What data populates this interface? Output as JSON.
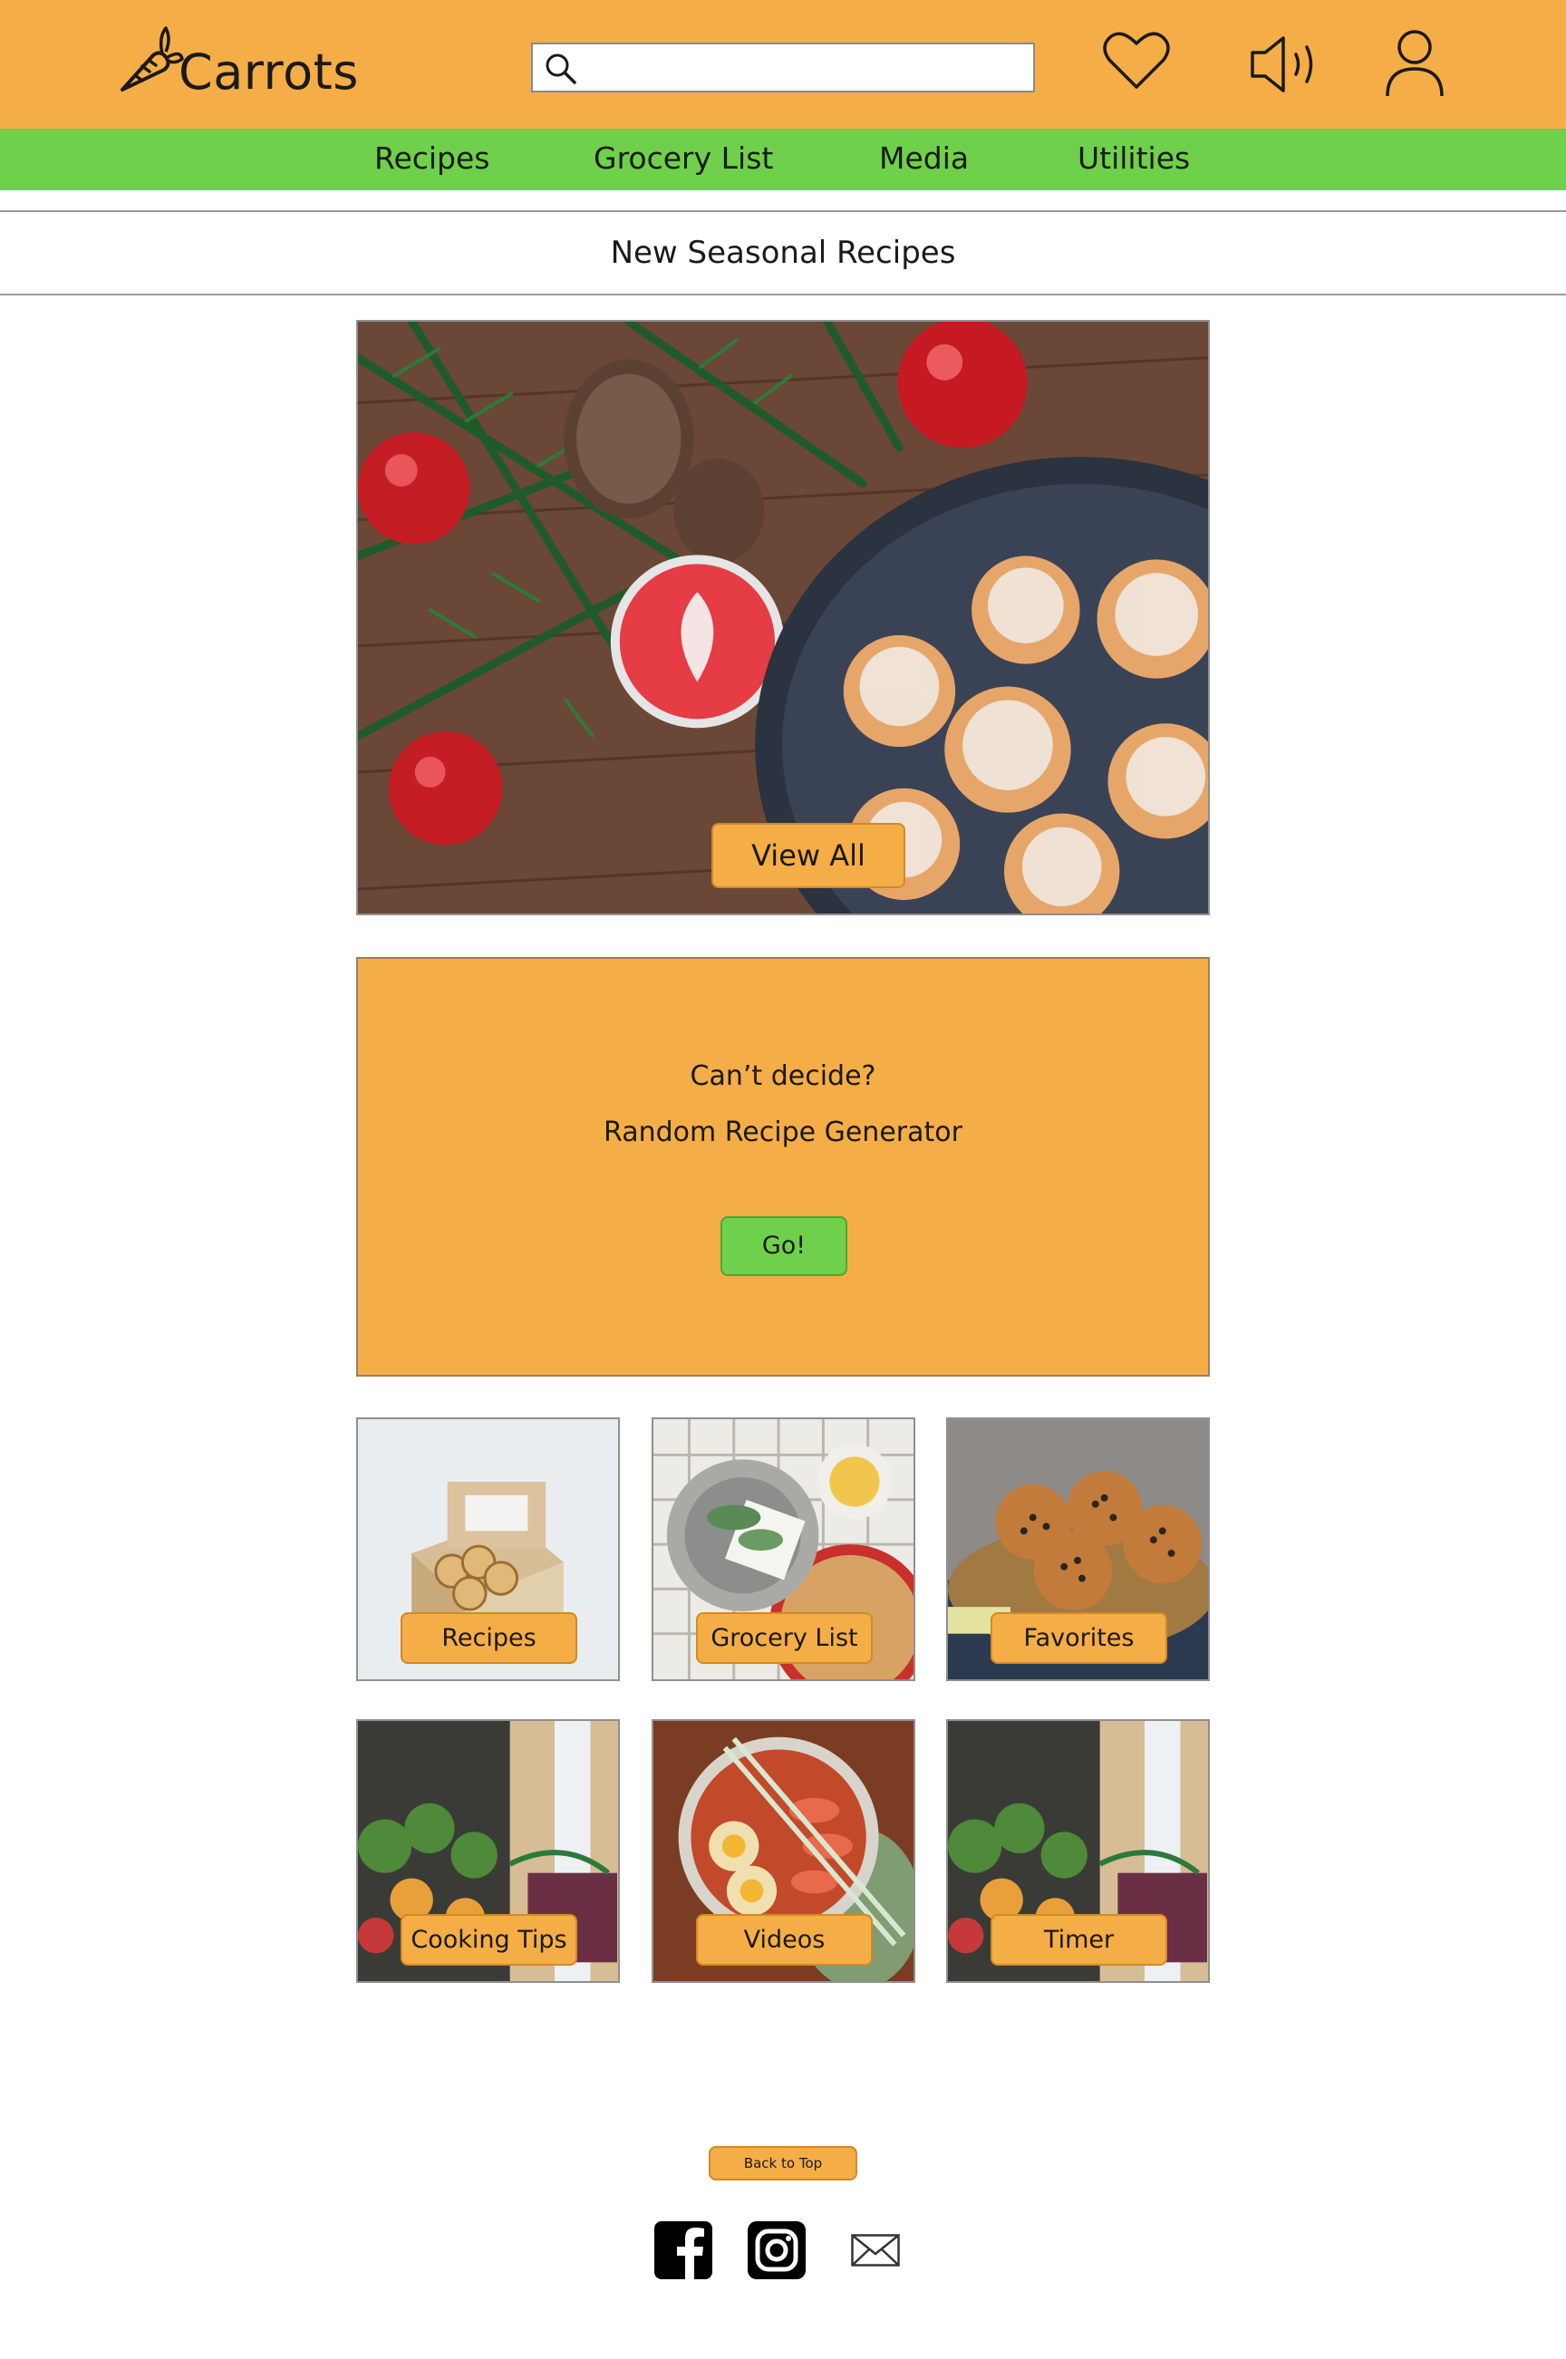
{
  "header": {
    "logo_text": "Carrots",
    "logo_icon": "carrot-icon",
    "search": {
      "value": "",
      "placeholder": ""
    },
    "icons": [
      "search-icon",
      "heart-icon",
      "speaker-icon",
      "user-icon"
    ]
  },
  "nav": {
    "items": [
      {
        "label": "Recipes"
      },
      {
        "label": "Grocery List"
      },
      {
        "label": "Media"
      },
      {
        "label": "Utilities"
      }
    ]
  },
  "section": {
    "title": "New Seasonal Recipes"
  },
  "hero": {
    "button_label": "View All"
  },
  "random": {
    "line1": "Can’t decide?",
    "line2": "Random Recipe Generator",
    "button_label": "Go!"
  },
  "tiles": [
    {
      "label": "Recipes"
    },
    {
      "label": "Grocery List"
    },
    {
      "label": "Favorites"
    },
    {
      "label": "Cooking Tips"
    },
    {
      "label": "Videos"
    },
    {
      "label": "Timer"
    }
  ],
  "footer": {
    "back_to_top": "Back to Top",
    "social_icons": [
      "facebook-icon",
      "instagram-icon",
      "mail-icon"
    ]
  },
  "colors": {
    "header": "#f5ad47",
    "nav": "#6fd04b",
    "accent_button": "#f5ad47",
    "go_button": "#6fd04b"
  }
}
